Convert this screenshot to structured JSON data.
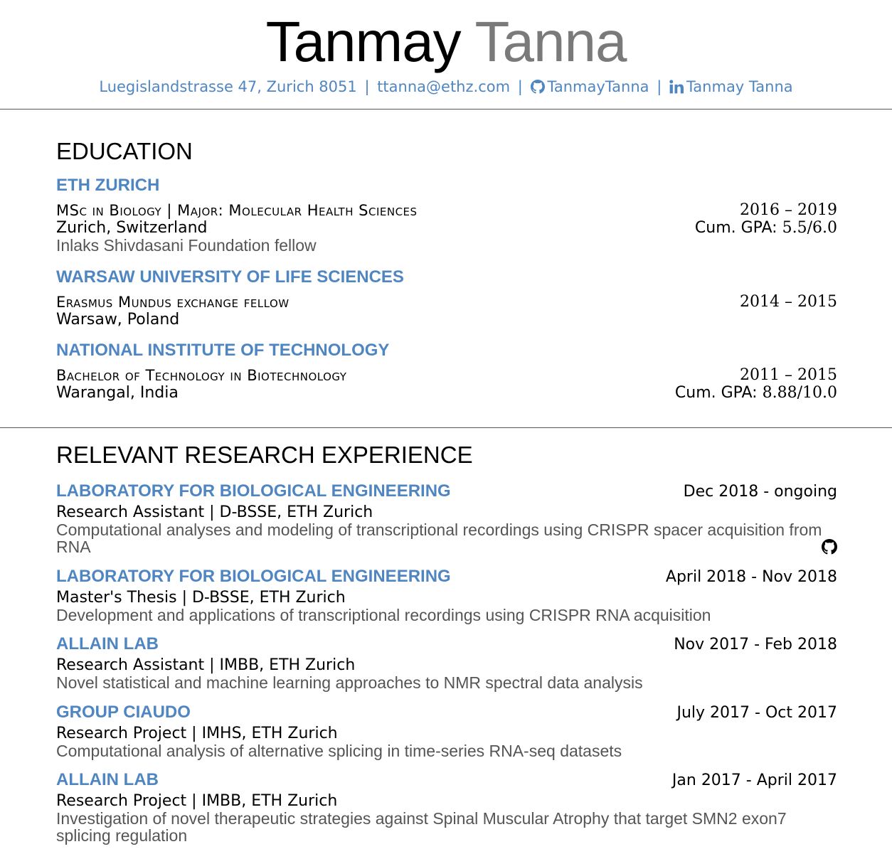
{
  "header": {
    "first_name": "Tanmay",
    "last_name": "Tanna",
    "address": "Luegislandstrasse 47, Zurich 8051",
    "email": "ttanna@ethz.com",
    "github": "TanmayTanna",
    "linkedin": "Tanmay Tanna",
    "separator": "|",
    "accent_color": "#4f86c2"
  },
  "education": {
    "title": "EDUCATION",
    "entries": [
      {
        "org": "ETH ZURICH",
        "degree": "MSc in Biology | Major: Molecular Health Sciences",
        "dates": "2016 – 2019",
        "location": "Zurich, Switzerland",
        "gpa_label": "Cum. GPA:",
        "gpa_value": "5.5/6.0",
        "note": "Inlaks Shivdasani Foundation fellow"
      },
      {
        "org": "WARSAW UNIVERSITY OF LIFE SCIENCES",
        "degree": "Erasmus Mundus exchange fellow",
        "dates": "2014 – 2015",
        "location": "Warsaw, Poland"
      },
      {
        "org": "NATIONAL INSTITUTE OF TECHNOLOGY",
        "degree": "Bachelor of Technology in Biotechnology",
        "dates": "2011 – 2015",
        "location": "Warangal, India",
        "gpa_label": "Cum. GPA:",
        "gpa_value": "8.88/10.0"
      }
    ]
  },
  "research": {
    "title": "RELEVANT RESEARCH EXPERIENCE",
    "entries": [
      {
        "org": "LABORATORY FOR BIOLOGICAL ENGINEERING",
        "dates": "Dec 2018 - ongoing",
        "role": "Research Assistant | D-BSSE, ETH Zurich",
        "description": "Computational analyses and modeling of transcriptional recordings using CRISPR spacer acquisition from RNA",
        "icon": "github-icon"
      },
      {
        "org": "LABORATORY FOR BIOLOGICAL ENGINEERING",
        "dates": "April 2018 - Nov 2018",
        "role": "Master's Thesis | D-BSSE, ETH Zurich",
        "description": "Development and applications of transcriptional recordings using CRISPR RNA acquisition"
      },
      {
        "org": "ALLAIN LAB",
        "dates": "Nov 2017 - Feb 2018",
        "role": "Research Assistant | IMBB, ETH Zurich",
        "description": "Novel statistical and machine learning approaches to NMR spectral data analysis"
      },
      {
        "org": "GROUP CIAUDO",
        "dates": "July 2017 - Oct 2017",
        "role": "Research Project | IMHS, ETH Zurich",
        "description": "Computational analysis of alternative splicing in time-series RNA-seq datasets"
      },
      {
        "org": "ALLAIN LAB",
        "dates": "Jan 2017 - April 2017",
        "role": "Research Project | IMBB, ETH Zurich",
        "description": "Investigation of novel therapeutic strategies against Spinal Muscular Atrophy that target SMN2 exon7 splicing regulation"
      }
    ]
  }
}
